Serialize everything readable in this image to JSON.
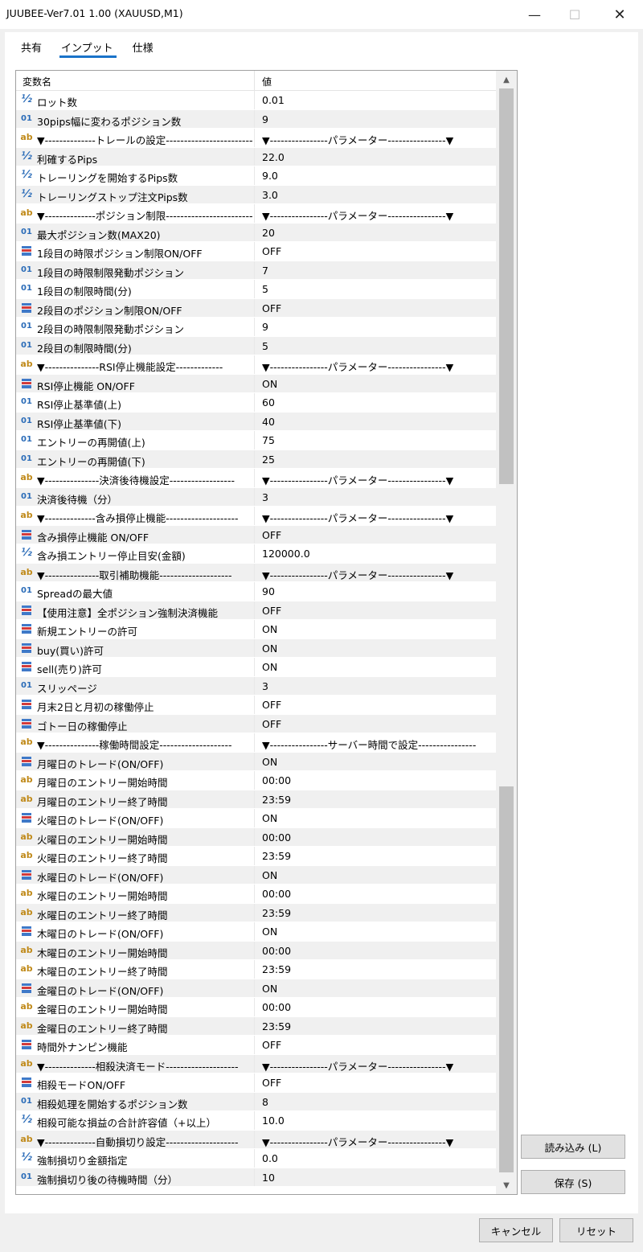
{
  "window": {
    "title": "JUUBEE-Ver7.01 1.00 (XAUUSD,M1)",
    "minimize_glyph": "—",
    "maximize_glyph": "☐",
    "close_glyph": "✕"
  },
  "tabs": [
    {
      "label": "共有"
    },
    {
      "label": "インプット",
      "active": true
    },
    {
      "label": "仕様"
    }
  ],
  "table": {
    "header_name": "変数名",
    "header_value": "値",
    "rows": [
      {
        "type": "half",
        "name": "ロット数",
        "value": "0.01"
      },
      {
        "type": "int",
        "name": "30pips幅に変わるポジション数",
        "value": "9"
      },
      {
        "type": "str",
        "name": "▼--------------トレールの設定-------------------------",
        "value": "▼----------------パラメーター----------------▼"
      },
      {
        "type": "half",
        "name": "利確するPips",
        "value": "22.0"
      },
      {
        "type": "half",
        "name": "トレーリングを開始するPips数",
        "value": "9.0"
      },
      {
        "type": "half",
        "name": "トレーリングストップ注文Pips数",
        "value": "3.0"
      },
      {
        "type": "str",
        "name": "▼--------------ポジション制限--------------------------",
        "value": "▼----------------パラメーター----------------▼"
      },
      {
        "type": "int",
        "name": "最大ポジション数(MAX20)",
        "value": "20"
      },
      {
        "type": "bool",
        "name": "1段目の時限ポジション制限ON/OFF",
        "value": "OFF"
      },
      {
        "type": "int",
        "name": "1段目の時限制限発動ポジション",
        "value": "7"
      },
      {
        "type": "int",
        "name": "1段目の制限時間(分)",
        "value": "5"
      },
      {
        "type": "bool",
        "name": "2段目のポジション制限ON/OFF",
        "value": "OFF"
      },
      {
        "type": "int",
        "name": "2段目の時限制限発動ポジション",
        "value": "9"
      },
      {
        "type": "int",
        "name": "2段目の制限時間(分)",
        "value": "5"
      },
      {
        "type": "str",
        "name": "▼---------------RSI停止機能設定-------------",
        "value": "▼----------------パラメーター----------------▼"
      },
      {
        "type": "bool",
        "name": "RSI停止機能 ON/OFF",
        "value": "ON"
      },
      {
        "type": "int",
        "name": "RSI停止基準値(上)",
        "value": "60"
      },
      {
        "type": "int",
        "name": "RSI停止基準値(下)",
        "value": "40"
      },
      {
        "type": "int",
        "name": "エントリーの再開値(上)",
        "value": "75"
      },
      {
        "type": "int",
        "name": "エントリーの再開値(下)",
        "value": "25"
      },
      {
        "type": "str",
        "name": "▼---------------決済後待機設定------------------",
        "value": "▼----------------パラメーター----------------▼"
      },
      {
        "type": "int",
        "name": "決済後待機（分）",
        "value": "3"
      },
      {
        "type": "str",
        "name": "▼--------------含み損停止機能--------------------",
        "value": "▼----------------パラメーター----------------▼"
      },
      {
        "type": "bool",
        "name": "含み損停止機能 ON/OFF",
        "value": "OFF"
      },
      {
        "type": "half",
        "name": "含み損エントリー停止目安(金額)",
        "value": "120000.0"
      },
      {
        "type": "str",
        "name": "▼---------------取引補助機能--------------------",
        "value": "▼----------------パラメーター----------------▼"
      },
      {
        "type": "int",
        "name": "Spreadの最大値",
        "value": "90"
      },
      {
        "type": "bool",
        "name": "【使用注意】全ポジション強制決済機能",
        "value": "OFF"
      },
      {
        "type": "bool",
        "name": "新規エントリーの許可",
        "value": "ON"
      },
      {
        "type": "bool",
        "name": "buy(買い)許可",
        "value": "ON"
      },
      {
        "type": "bool",
        "name": "sell(売り)許可",
        "value": "ON"
      },
      {
        "type": "int",
        "name": "スリッページ",
        "value": "3"
      },
      {
        "type": "bool",
        "name": "月末2日と月初の稼働停止",
        "value": "OFF"
      },
      {
        "type": "bool",
        "name": "ゴトー日の稼働停止",
        "value": "OFF"
      },
      {
        "type": "str",
        "name": "▼---------------稼働時間設定--------------------",
        "value": "▼----------------サーバー時間で設定----------------"
      },
      {
        "type": "bool",
        "name": "月曜日のトレード(ON/OFF)",
        "value": "ON"
      },
      {
        "type": "str",
        "name": "月曜日のエントリー開始時間",
        "value": "00:00"
      },
      {
        "type": "str",
        "name": "月曜日のエントリー終了時間",
        "value": "23:59"
      },
      {
        "type": "bool",
        "name": "火曜日のトレード(ON/OFF)",
        "value": "ON"
      },
      {
        "type": "str",
        "name": "火曜日のエントリー開始時間",
        "value": "00:00"
      },
      {
        "type": "str",
        "name": "火曜日のエントリー終了時間",
        "value": "23:59"
      },
      {
        "type": "bool",
        "name": "水曜日のトレード(ON/OFF)",
        "value": "ON"
      },
      {
        "type": "str",
        "name": "水曜日のエントリー開始時間",
        "value": "00:00"
      },
      {
        "type": "str",
        "name": "水曜日のエントリー終了時間",
        "value": "23:59"
      },
      {
        "type": "bool",
        "name": "木曜日のトレード(ON/OFF)",
        "value": "ON"
      },
      {
        "type": "str",
        "name": "木曜日のエントリー開始時間",
        "value": "00:00"
      },
      {
        "type": "str",
        "name": "木曜日のエントリー終了時間",
        "value": "23:59"
      },
      {
        "type": "bool",
        "name": "金曜日のトレード(ON/OFF)",
        "value": "ON"
      },
      {
        "type": "str",
        "name": "金曜日のエントリー開始時間",
        "value": "00:00"
      },
      {
        "type": "str",
        "name": "金曜日のエントリー終了時間",
        "value": "23:59"
      },
      {
        "type": "bool",
        "name": "時間外ナンピン機能",
        "value": "OFF"
      },
      {
        "type": "str",
        "name": "▼--------------相殺決済モード--------------------",
        "value": "▼----------------パラメーター----------------▼"
      },
      {
        "type": "bool",
        "name": "相殺モードON/OFF",
        "value": "OFF"
      },
      {
        "type": "int",
        "name": "相殺処理を開始するポジション数",
        "value": "8"
      },
      {
        "type": "half",
        "name": "相殺可能な損益の合計許容値（+以上）",
        "value": "10.0"
      },
      {
        "type": "str",
        "name": "▼--------------自動損切り設定--------------------",
        "value": "▼----------------パラメーター----------------▼"
      },
      {
        "type": "half",
        "name": "強制損切り金額指定",
        "value": "0.0"
      },
      {
        "type": "int",
        "name": "強制損切り後の待機時間（分）",
        "value": "10"
      }
    ]
  },
  "icon_glyphs": {
    "half": "½",
    "int": "01",
    "str": "ab"
  },
  "scroll": {
    "up_glyph": "▲",
    "down_glyph": "▼"
  },
  "buttons": {
    "load": "読み込み (L)",
    "save": "保存 (S)",
    "cancel": "キャンセル",
    "reset": "リセット"
  }
}
